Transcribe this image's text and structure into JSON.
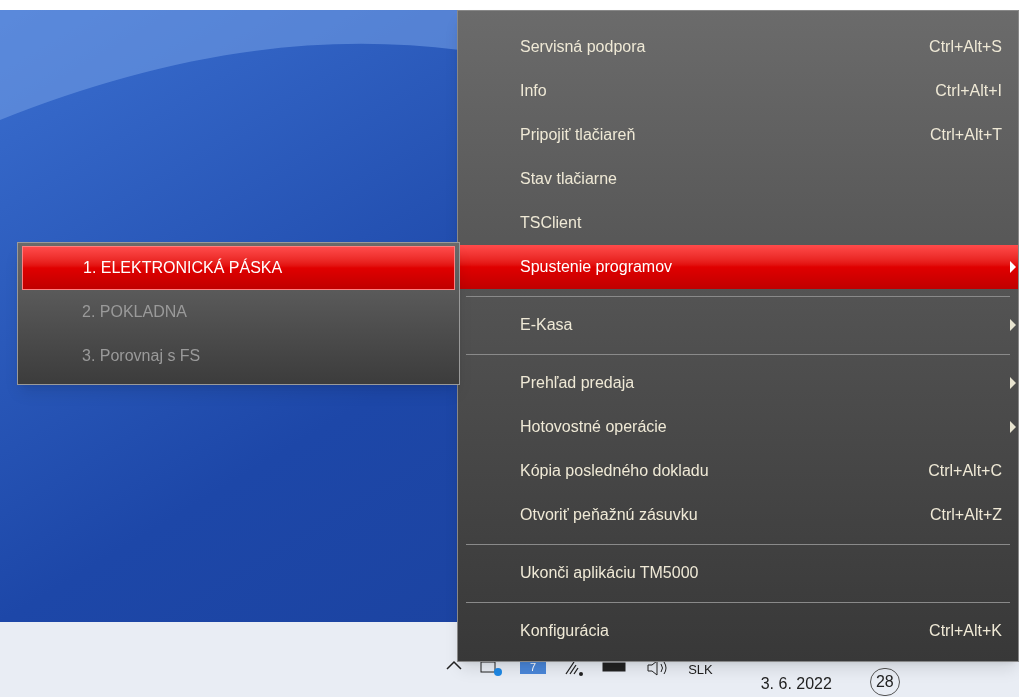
{
  "menu": {
    "items": [
      {
        "kind": "item",
        "label": "Servisná podpora",
        "shortcut": "Ctrl+Alt+S",
        "selected": false,
        "has_submenu": false
      },
      {
        "kind": "item",
        "label": "Info",
        "shortcut": "Ctrl+Alt+I",
        "selected": false,
        "has_submenu": false
      },
      {
        "kind": "item",
        "label": "Pripojiť tlačiareň",
        "shortcut": "Ctrl+Alt+T",
        "selected": false,
        "has_submenu": false
      },
      {
        "kind": "item",
        "label": "Stav tlačiarne",
        "selected": false,
        "has_submenu": false
      },
      {
        "kind": "item",
        "label": "TSClient",
        "selected": false,
        "has_submenu": false
      },
      {
        "kind": "item",
        "label": "Spustenie programov",
        "selected": true,
        "has_submenu": true
      },
      {
        "kind": "separator"
      },
      {
        "kind": "item",
        "label": "E-Kasa",
        "selected": false,
        "has_submenu": true
      },
      {
        "kind": "separator"
      },
      {
        "kind": "item",
        "label": "Prehľad predaja",
        "selected": false,
        "has_submenu": true
      },
      {
        "kind": "item",
        "label": "Hotovostné operácie",
        "selected": false,
        "has_submenu": true
      },
      {
        "kind": "item",
        "label": "Kópia posledného dokladu",
        "shortcut": "Ctrl+Alt+C",
        "selected": false,
        "has_submenu": false
      },
      {
        "kind": "item",
        "label": "Otvoriť peňažnú zásuvku",
        "shortcut": "Ctrl+Alt+Z",
        "selected": false,
        "has_submenu": false
      },
      {
        "kind": "separator"
      },
      {
        "kind": "item",
        "label": "Ukonči aplikáciu TM5000",
        "selected": false,
        "has_submenu": false
      },
      {
        "kind": "separator"
      },
      {
        "kind": "item",
        "label": "Konfigurácia",
        "shortcut": "Ctrl+Alt+K",
        "selected": false,
        "has_submenu": false
      }
    ]
  },
  "submenu": {
    "items": [
      {
        "label": "1. ELEKTRONICKÁ PÁSKA",
        "selected": true,
        "disabled": false
      },
      {
        "label": "2. POKLADNA",
        "selected": false,
        "disabled": true
      },
      {
        "label": "3. Porovnaj s FS",
        "selected": false,
        "disabled": true
      }
    ]
  },
  "taskbar": {
    "language": "SLK",
    "date": "3. 6. 2022",
    "notification_count": "28",
    "badge": "7"
  }
}
